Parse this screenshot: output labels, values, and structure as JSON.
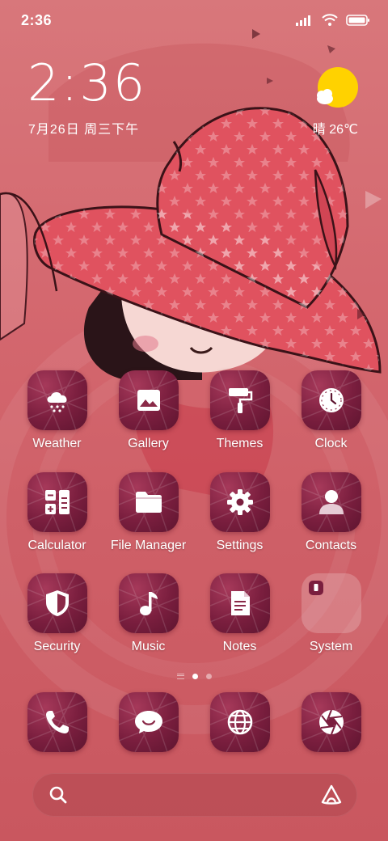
{
  "status_bar": {
    "time": "2:36",
    "icons": [
      "signal-icon",
      "wifi-icon",
      "battery-icon"
    ]
  },
  "clock_widget": {
    "time": "2:36",
    "date": "7月26日 周三下午"
  },
  "weather_widget": {
    "icon": "sun-cloud-icon",
    "text": "晴 26℃"
  },
  "apps": [
    {
      "label": "Weather",
      "icon": "weather-icon"
    },
    {
      "label": "Gallery",
      "icon": "gallery-icon"
    },
    {
      "label": "Themes",
      "icon": "paint-roller-icon"
    },
    {
      "label": "Clock",
      "icon": "clock-icon"
    },
    {
      "label": "Calculator",
      "icon": "calculator-icon"
    },
    {
      "label": "File Manager",
      "icon": "folder-icon"
    },
    {
      "label": "Settings",
      "icon": "gear-icon"
    },
    {
      "label": "Contacts",
      "icon": "person-icon"
    },
    {
      "label": "Security",
      "icon": "shield-icon"
    },
    {
      "label": "Music",
      "icon": "music-note-icon"
    },
    {
      "label": "Notes",
      "icon": "note-icon"
    },
    {
      "label": "System",
      "icon": "folder-group-icon"
    }
  ],
  "dock": [
    {
      "icon": "phone-icon"
    },
    {
      "icon": "messages-icon"
    },
    {
      "icon": "browser-globe-icon"
    },
    {
      "icon": "camera-shutter-icon"
    }
  ],
  "pager": {
    "pages": 2,
    "current": 1
  },
  "search_bar": {
    "left_icon": "search-icon",
    "right_icon": "assistant-icon"
  },
  "colors": {
    "background": "#d4686f",
    "icon_bg": "#7a1e3e",
    "hat": "#e0525f",
    "sun": "#ffd200"
  }
}
